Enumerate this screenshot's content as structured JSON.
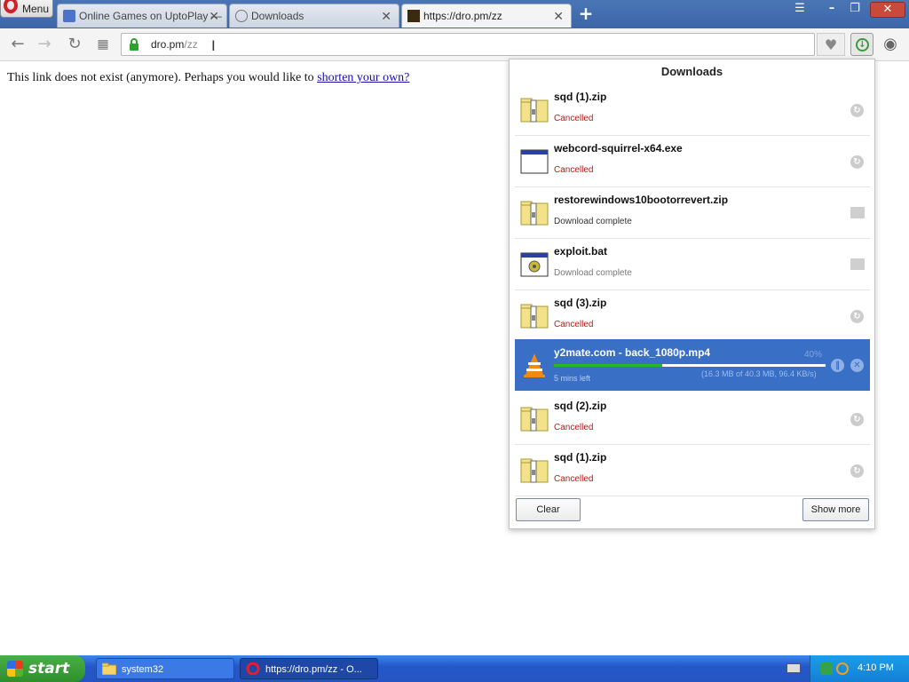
{
  "browser": {
    "menu_label": "Menu",
    "tabs": [
      {
        "label": "Online Games on UptoPlay —",
        "active": false
      },
      {
        "label": "Downloads",
        "active": false
      },
      {
        "label": "https://dro.pm/zz",
        "active": true
      }
    ]
  },
  "address_bar": {
    "host": "dro.pm",
    "path": "/zz"
  },
  "page": {
    "text": "This link does not exist (anymore). Perhaps you would like to",
    "link": "shorten your own?"
  },
  "downloads": {
    "title": "Downloads",
    "items": [
      {
        "name": "sqd (1).zip",
        "status": "Cancelled",
        "icon": "zip-icon",
        "action": "retry"
      },
      {
        "name": "webcord-squirrel-x64.exe",
        "status": "Cancelled",
        "icon": "exe-icon",
        "action": "retry"
      },
      {
        "name": "restorewindows10bootorrevert.zip",
        "status": "Download complete",
        "icon": "zip-icon",
        "action": "folder"
      },
      {
        "name": "exploit.bat",
        "status": "Download complete",
        "icon": "bat-icon",
        "action": "folder"
      },
      {
        "name": "sqd (3).zip",
        "status": "Cancelled",
        "icon": "zip-icon",
        "action": "retry"
      },
      {
        "name": "y2mate.com - back_1080p.mp4",
        "status": "5 mins left",
        "icon": "vlc-icon",
        "action": "in-progress",
        "percent_label": "40%",
        "size_info": "(16.3 MB of 40.3 MB, 96.4 KB/s)",
        "progress": 0.4
      },
      {
        "name": "sqd (2).zip",
        "status": "Cancelled",
        "icon": "zip-icon",
        "action": "retry"
      },
      {
        "name": "sqd (1).zip",
        "status": "Cancelled",
        "icon": "zip-icon",
        "action": "retry"
      }
    ],
    "clear_label": "Clear",
    "show_more_label": "Show more"
  },
  "taskbar": {
    "start_label": "start",
    "tasks": [
      {
        "label": "system32"
      },
      {
        "label": "https://dro.pm/zz - O..."
      }
    ],
    "clock": "4:10 PM"
  }
}
